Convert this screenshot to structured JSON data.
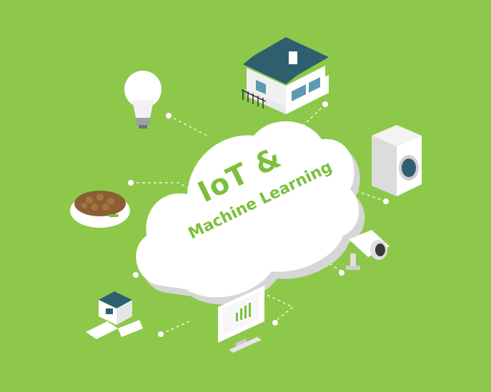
{
  "colors": {
    "background": "#8dc84a",
    "accent": "#7cbf3c",
    "cloud": "#ffffff",
    "cloud_shadow": "#d6d6d6",
    "device_dark": "#2f5f6e",
    "connector": "#ffffff"
  },
  "cloud": {
    "title_line1": "IoT &",
    "title_line2": "Machine Learning"
  },
  "devices": [
    {
      "icon": "smart-home-icon"
    },
    {
      "icon": "light-bulb-icon"
    },
    {
      "icon": "washing-machine-icon"
    },
    {
      "icon": "pet-food-bowl-icon"
    },
    {
      "icon": "security-camera-icon"
    },
    {
      "icon": "robot-icon"
    },
    {
      "icon": "analytics-monitor-icon"
    }
  ]
}
